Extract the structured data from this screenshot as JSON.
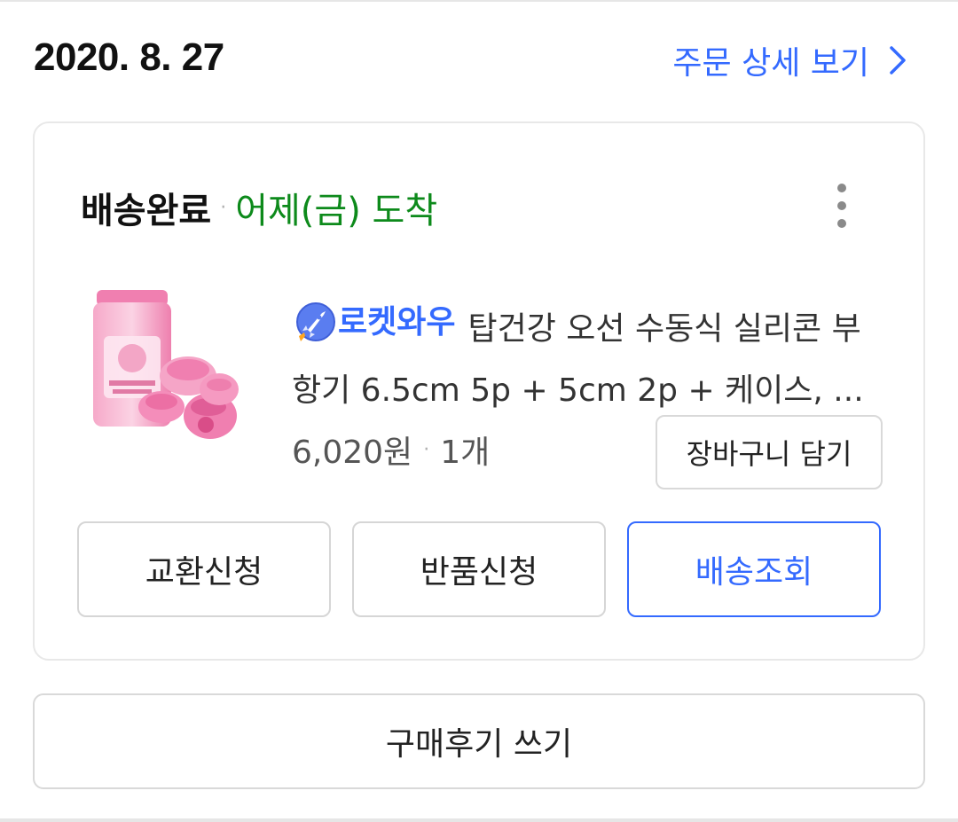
{
  "order": {
    "date": "2020. 8. 27",
    "detail_link_label": "주문 상세 보기"
  },
  "shipment": {
    "status": "배송완료",
    "separator": "·",
    "arrival": "어제(금) 도착",
    "more_icon": "more-vertical-icon"
  },
  "product": {
    "badge_text": "로켓와우",
    "badge_icon": "rocket-icon",
    "name": "탑건강 오선 수동식 실리콘 부항기 6.5cm 5p + 5cm 2p + 케이스, ...",
    "price": "6,020원",
    "quantity": "1개",
    "cart_button_label": "장바구니 담기"
  },
  "actions": {
    "exchange_label": "교환신청",
    "return_label": "반품신청",
    "track_label": "배송조회"
  },
  "review_button_label": "구매후기 쓰기",
  "colors": {
    "accent_blue": "#346aff",
    "arrival_green": "#0d8a1b",
    "product_pink": "#f07fb0"
  }
}
